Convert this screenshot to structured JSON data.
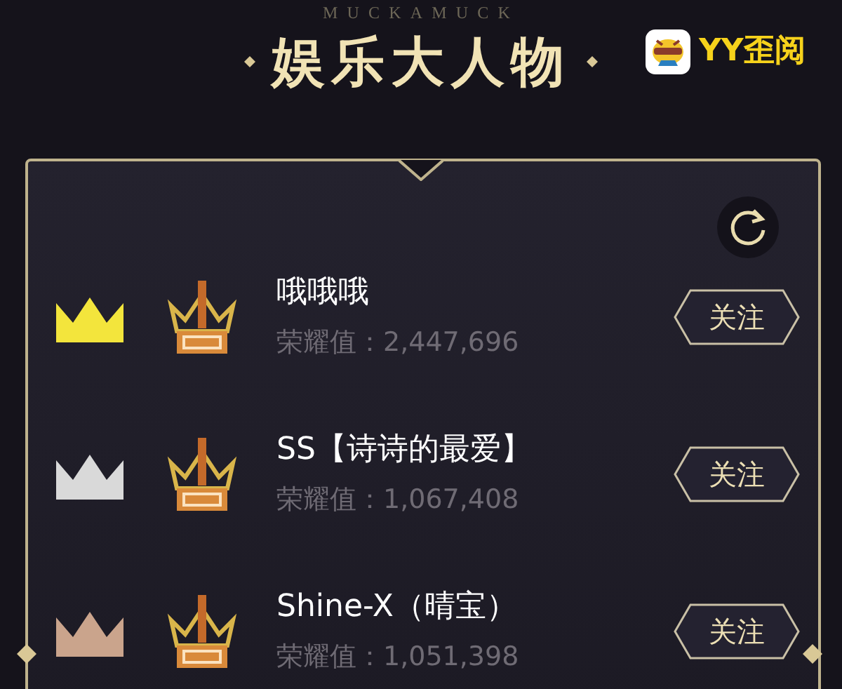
{
  "header": {
    "subtitle": "MUCKAMUCK",
    "title": "娱乐大人物",
    "logo_text": "YY歪阅"
  },
  "ranking": [
    {
      "name": "哦哦哦",
      "score": "荣耀值：2,447,696",
      "color": "#f3e53c",
      "action": "关注"
    },
    {
      "name": "SS【诗诗的最爱】",
      "score": "荣耀值：1,067,408",
      "color": "#d9d9d9",
      "action": "关注"
    },
    {
      "name": "Shine-X（晴宝）",
      "score": "荣耀值：1,051,398",
      "color": "#caa48c",
      "action": "关注"
    }
  ]
}
